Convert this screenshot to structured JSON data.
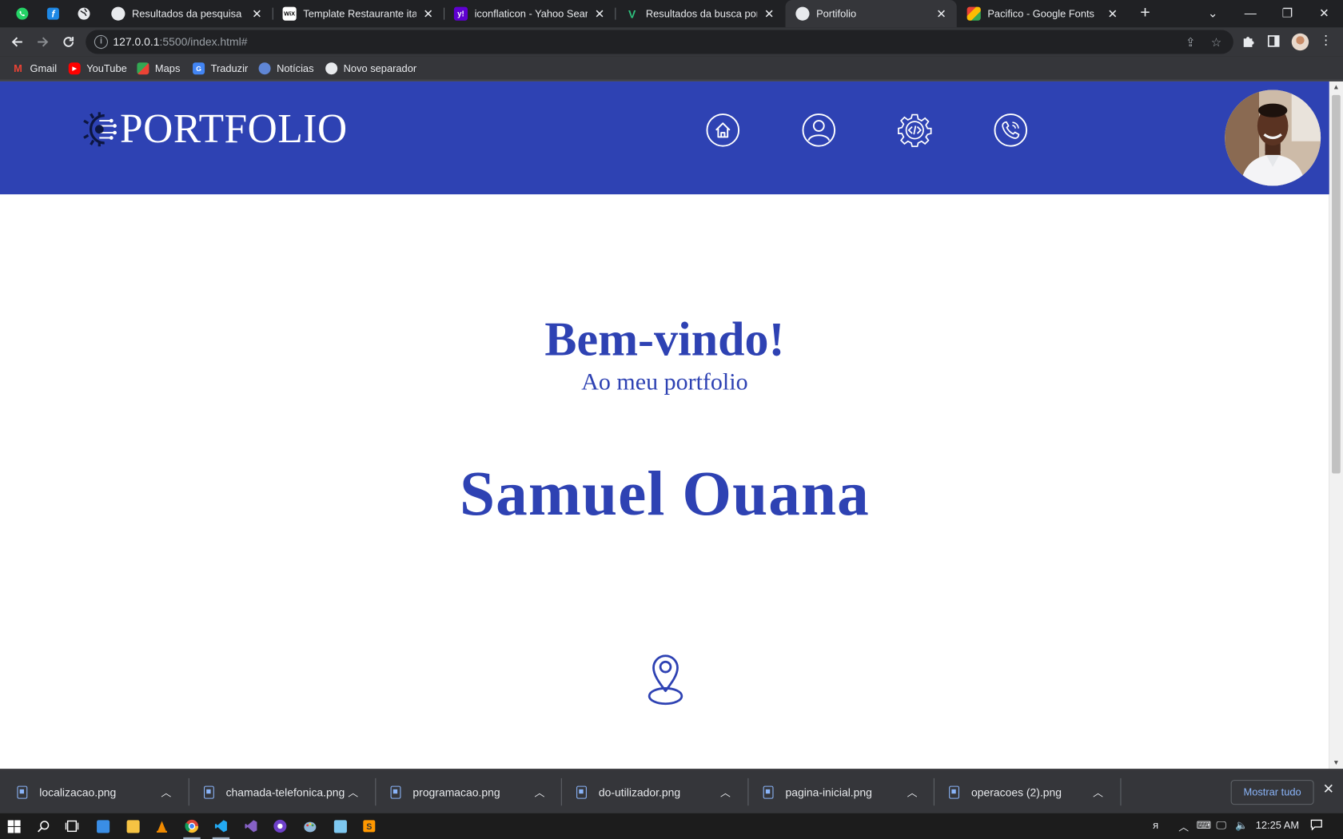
{
  "browser": {
    "pinned_tabs": [
      {
        "icon": "whatsapp-icon",
        "color": "#25d366"
      },
      {
        "icon": "figma-icon",
        "color": "#1e88e5"
      },
      {
        "icon": "globe-icon",
        "color": "#e8eaed"
      }
    ],
    "tabs": [
      {
        "title": "Resultados da pesquisa para",
        "icon": "globe-icon",
        "active": false
      },
      {
        "title": "Template Restaurante italian",
        "icon": "wix-icon",
        "active": false
      },
      {
        "title": "iconflaticon - Yahoo Search",
        "icon": "yahoo-icon",
        "active": false
      },
      {
        "title": "Resultados da busca por Ge",
        "icon": "vector-icon",
        "active": false
      },
      {
        "title": "Portifolio",
        "icon": "globe-icon",
        "active": true
      },
      {
        "title": "Pacifico - Google Fonts",
        "icon": "google-fonts-icon",
        "active": false
      }
    ],
    "url_host": "127.0.0.1",
    "url_rest": ":5500/index.html#",
    "bookmarks": [
      {
        "label": "Gmail",
        "icon": "gmail-icon"
      },
      {
        "label": "YouTube",
        "icon": "youtube-icon"
      },
      {
        "label": "Maps",
        "icon": "maps-icon"
      },
      {
        "label": "Traduzir",
        "icon": "translate-icon"
      },
      {
        "label": "Notícias",
        "icon": "news-icon"
      },
      {
        "label": "Novo separador",
        "icon": "globe-icon"
      }
    ]
  },
  "page": {
    "brand": "PORTFOLIO",
    "nav": [
      {
        "name": "home-icon"
      },
      {
        "name": "user-icon"
      },
      {
        "name": "code-gear-icon"
      },
      {
        "name": "phone-icon"
      }
    ],
    "welcome": "Bem-vindo!",
    "subtitle": "Ao meu portfolio",
    "name": "Samuel Ouana",
    "accent": "#2e42b3"
  },
  "downloads": {
    "items": [
      "localizacao.png",
      "chamada-telefonica.png",
      "programacao.png",
      "do-utilizador.png",
      "pagina-inicial.png",
      "operacoes (2).png"
    ],
    "show_all": "Mostrar tudo"
  },
  "taskbar": {
    "time": "12:25 AM"
  }
}
